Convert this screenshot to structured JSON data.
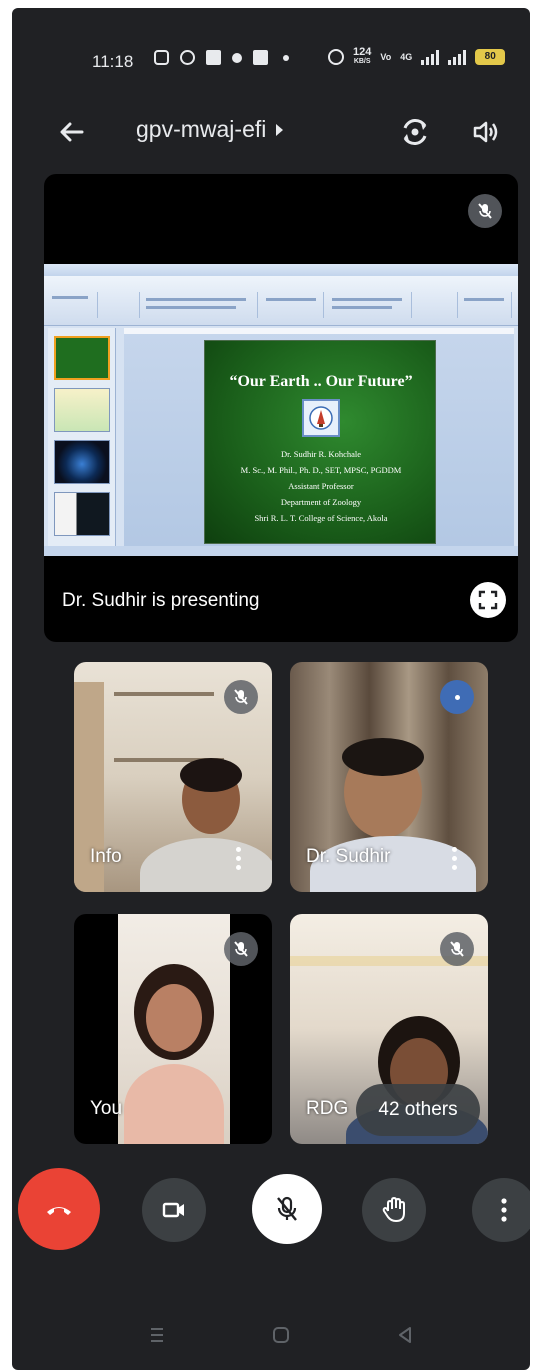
{
  "status_bar": {
    "time": "11:18",
    "net_speed_value": "124",
    "net_speed_unit": "KB/S",
    "network_type": "4G",
    "battery": "80"
  },
  "app_bar": {
    "meeting_code": "gpv-mwaj-efi"
  },
  "presentation": {
    "presenting_text": "Dr. Sudhir is presenting",
    "slide": {
      "title": "“Our Earth .. Our Future”",
      "lines": [
        "Dr. Sudhir R. Kohchale",
        "M. Sc., M. Phil., Ph. D., SET, MPSC, PGDDM",
        "Assistant Professor",
        "Department of Zoology",
        "Shri R. L. T. College of Science, Akola"
      ]
    }
  },
  "participants": [
    {
      "name": "Info",
      "muted": true
    },
    {
      "name": "Dr. Sudhir",
      "muted": false
    },
    {
      "name": "You",
      "muted": true
    },
    {
      "name": "RDG",
      "muted": true
    }
  ],
  "others_chip": "42 others",
  "colors": {
    "background": "#202124",
    "end_call": "#ea4335",
    "control_dark": "#3c4043",
    "speaking_indicator": "#3f6cb5",
    "slide_green": "#1a5e1a"
  },
  "controls": [
    {
      "icon": "end-call-icon"
    },
    {
      "icon": "video-camera-icon"
    },
    {
      "icon": "mic-off-icon"
    },
    {
      "icon": "raise-hand-icon"
    },
    {
      "icon": "more-vert-icon"
    }
  ],
  "nav": [
    "recent-apps-icon",
    "home-icon",
    "back-icon"
  ]
}
